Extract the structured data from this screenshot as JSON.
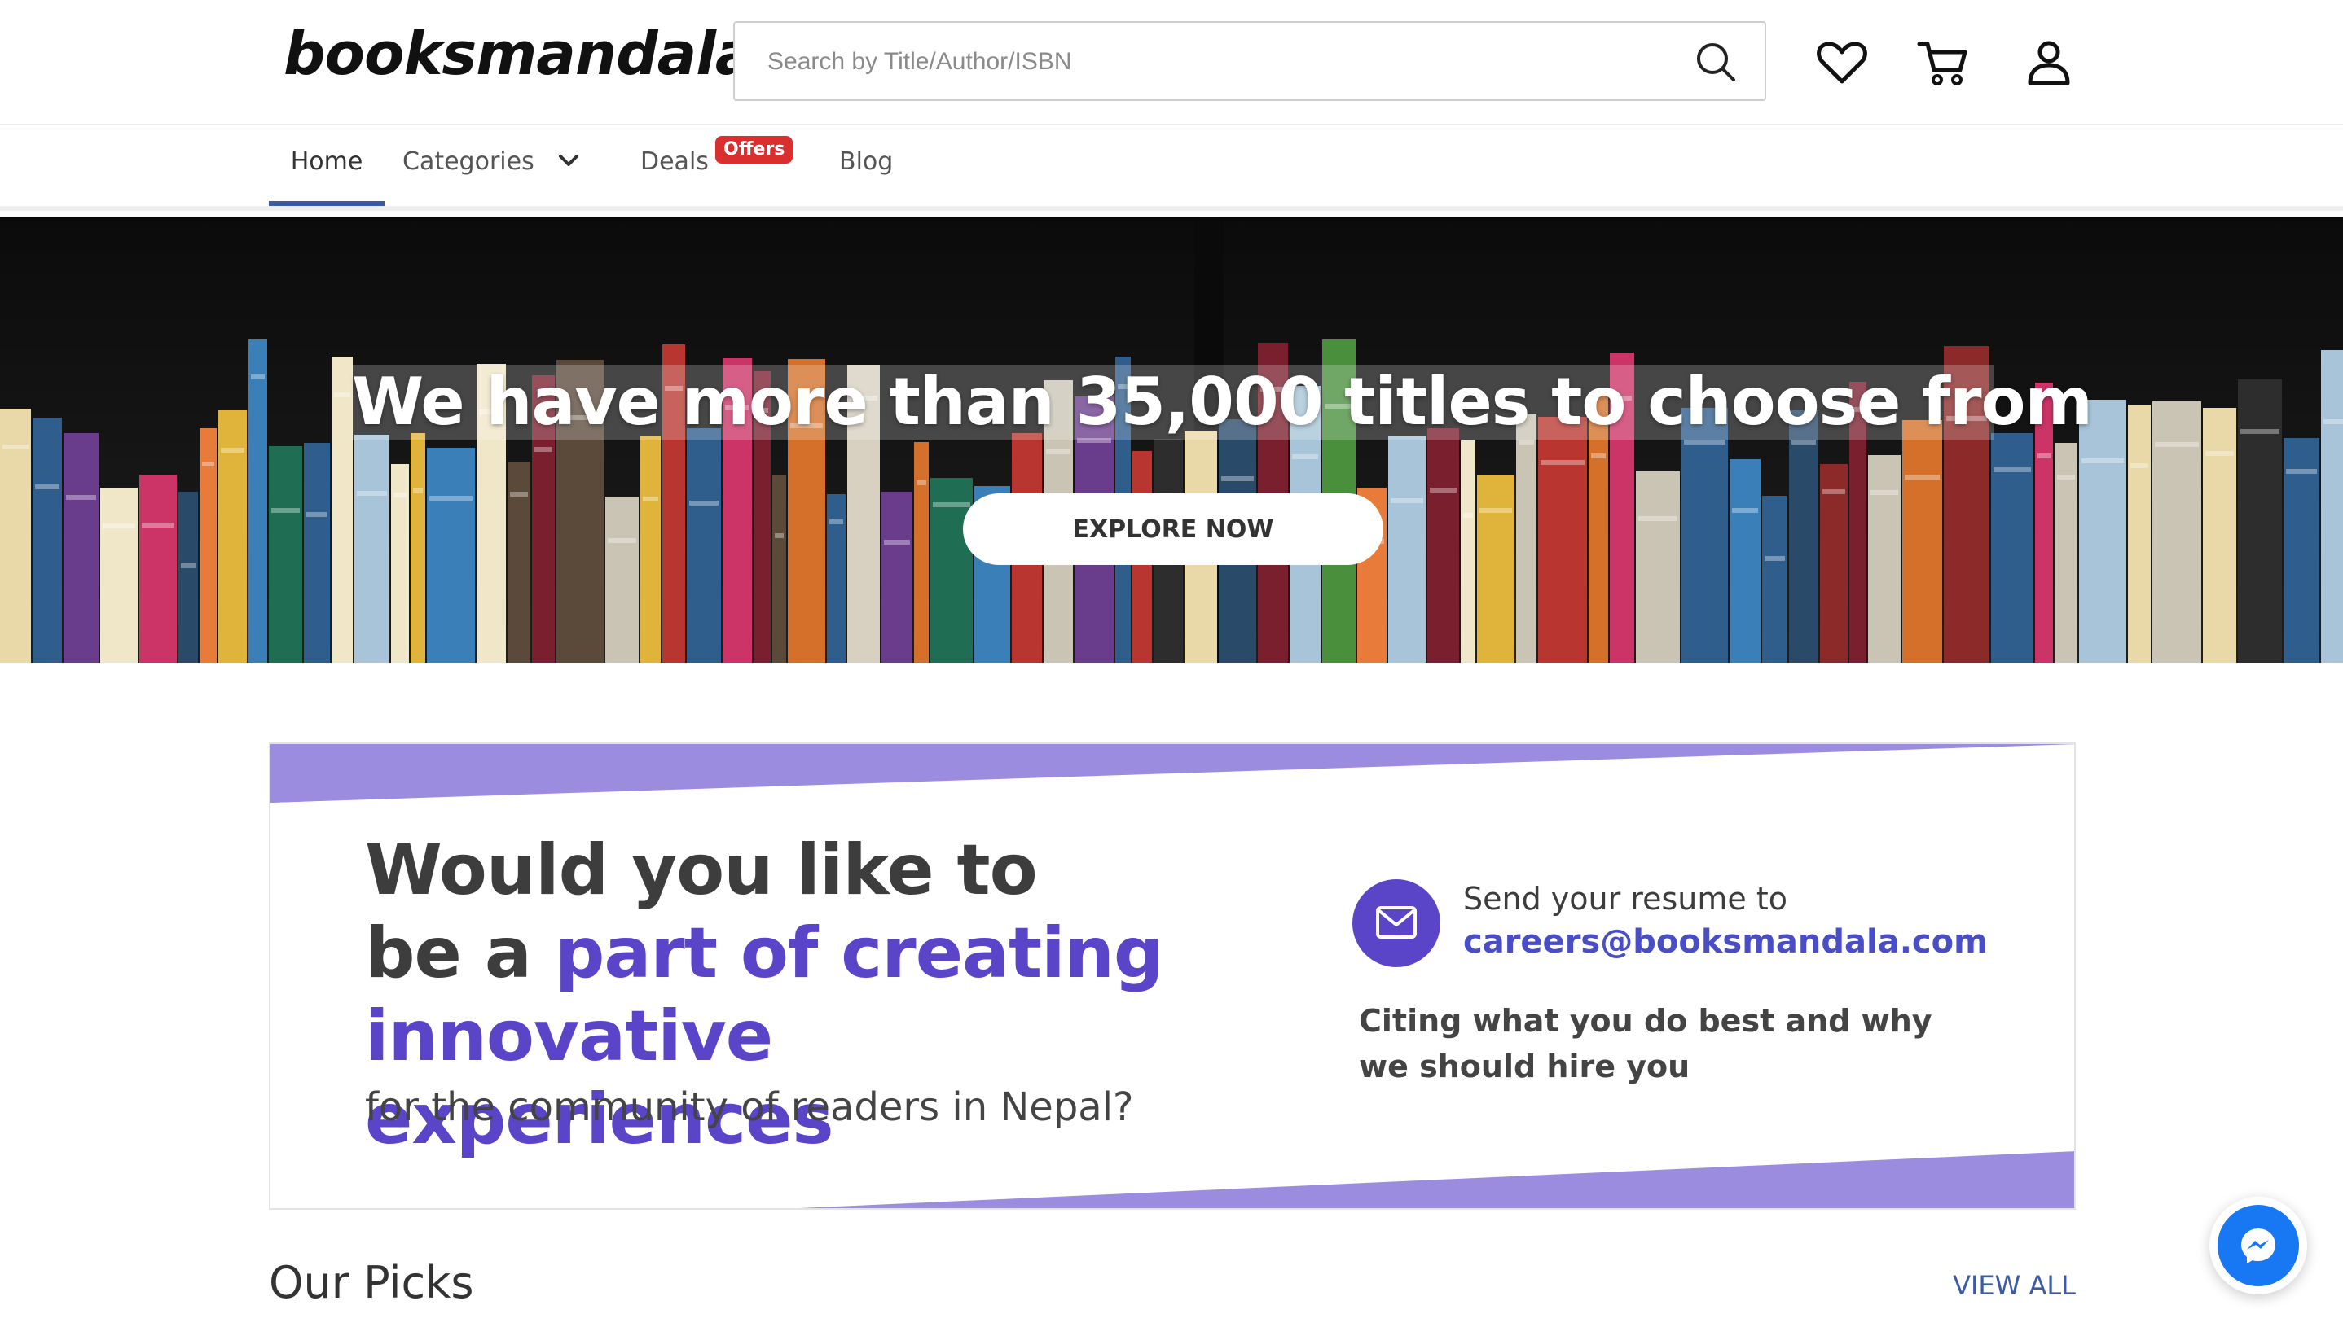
{
  "header": {
    "logo_text": "booksmandala",
    "search": {
      "placeholder": "Search by Title/Author/ISBN",
      "value": ""
    },
    "icons": [
      "search-icon",
      "heart-icon",
      "cart-icon",
      "user-icon"
    ]
  },
  "nav": {
    "items": [
      {
        "label": "Home",
        "active": true
      },
      {
        "label": "Categories",
        "icon": "chevron-down-icon"
      },
      {
        "label": "Deals",
        "badge": "Offers"
      },
      {
        "label": "Blog"
      }
    ]
  },
  "hero": {
    "title": "We have more than 35,000 titles to choose from",
    "cta_label": "EXPLORE NOW"
  },
  "careers": {
    "heading_line1": "Would you like to",
    "heading_line2_plain": "be a ",
    "heading_line2_accent": "part of creating",
    "heading_line3_accent": "innovative experiences",
    "subheading": "for the community of readers in Nepal?",
    "send_text": "Send your resume to",
    "email": "careers@booksmandala.com",
    "citing_line1": "Citing what you do best and why",
    "citing_line2": "we should hire you",
    "icon": "mail-icon"
  },
  "picks": {
    "title": "Our Picks",
    "view_all_label": "VIEW ALL"
  },
  "colors": {
    "accent_purple": "#5a45c9",
    "stripe_purple": "#9b8ce0",
    "nav_active": "#3c5aa6",
    "offers_badge": "#d92f2f",
    "messenger_blue": "#1877f2"
  }
}
